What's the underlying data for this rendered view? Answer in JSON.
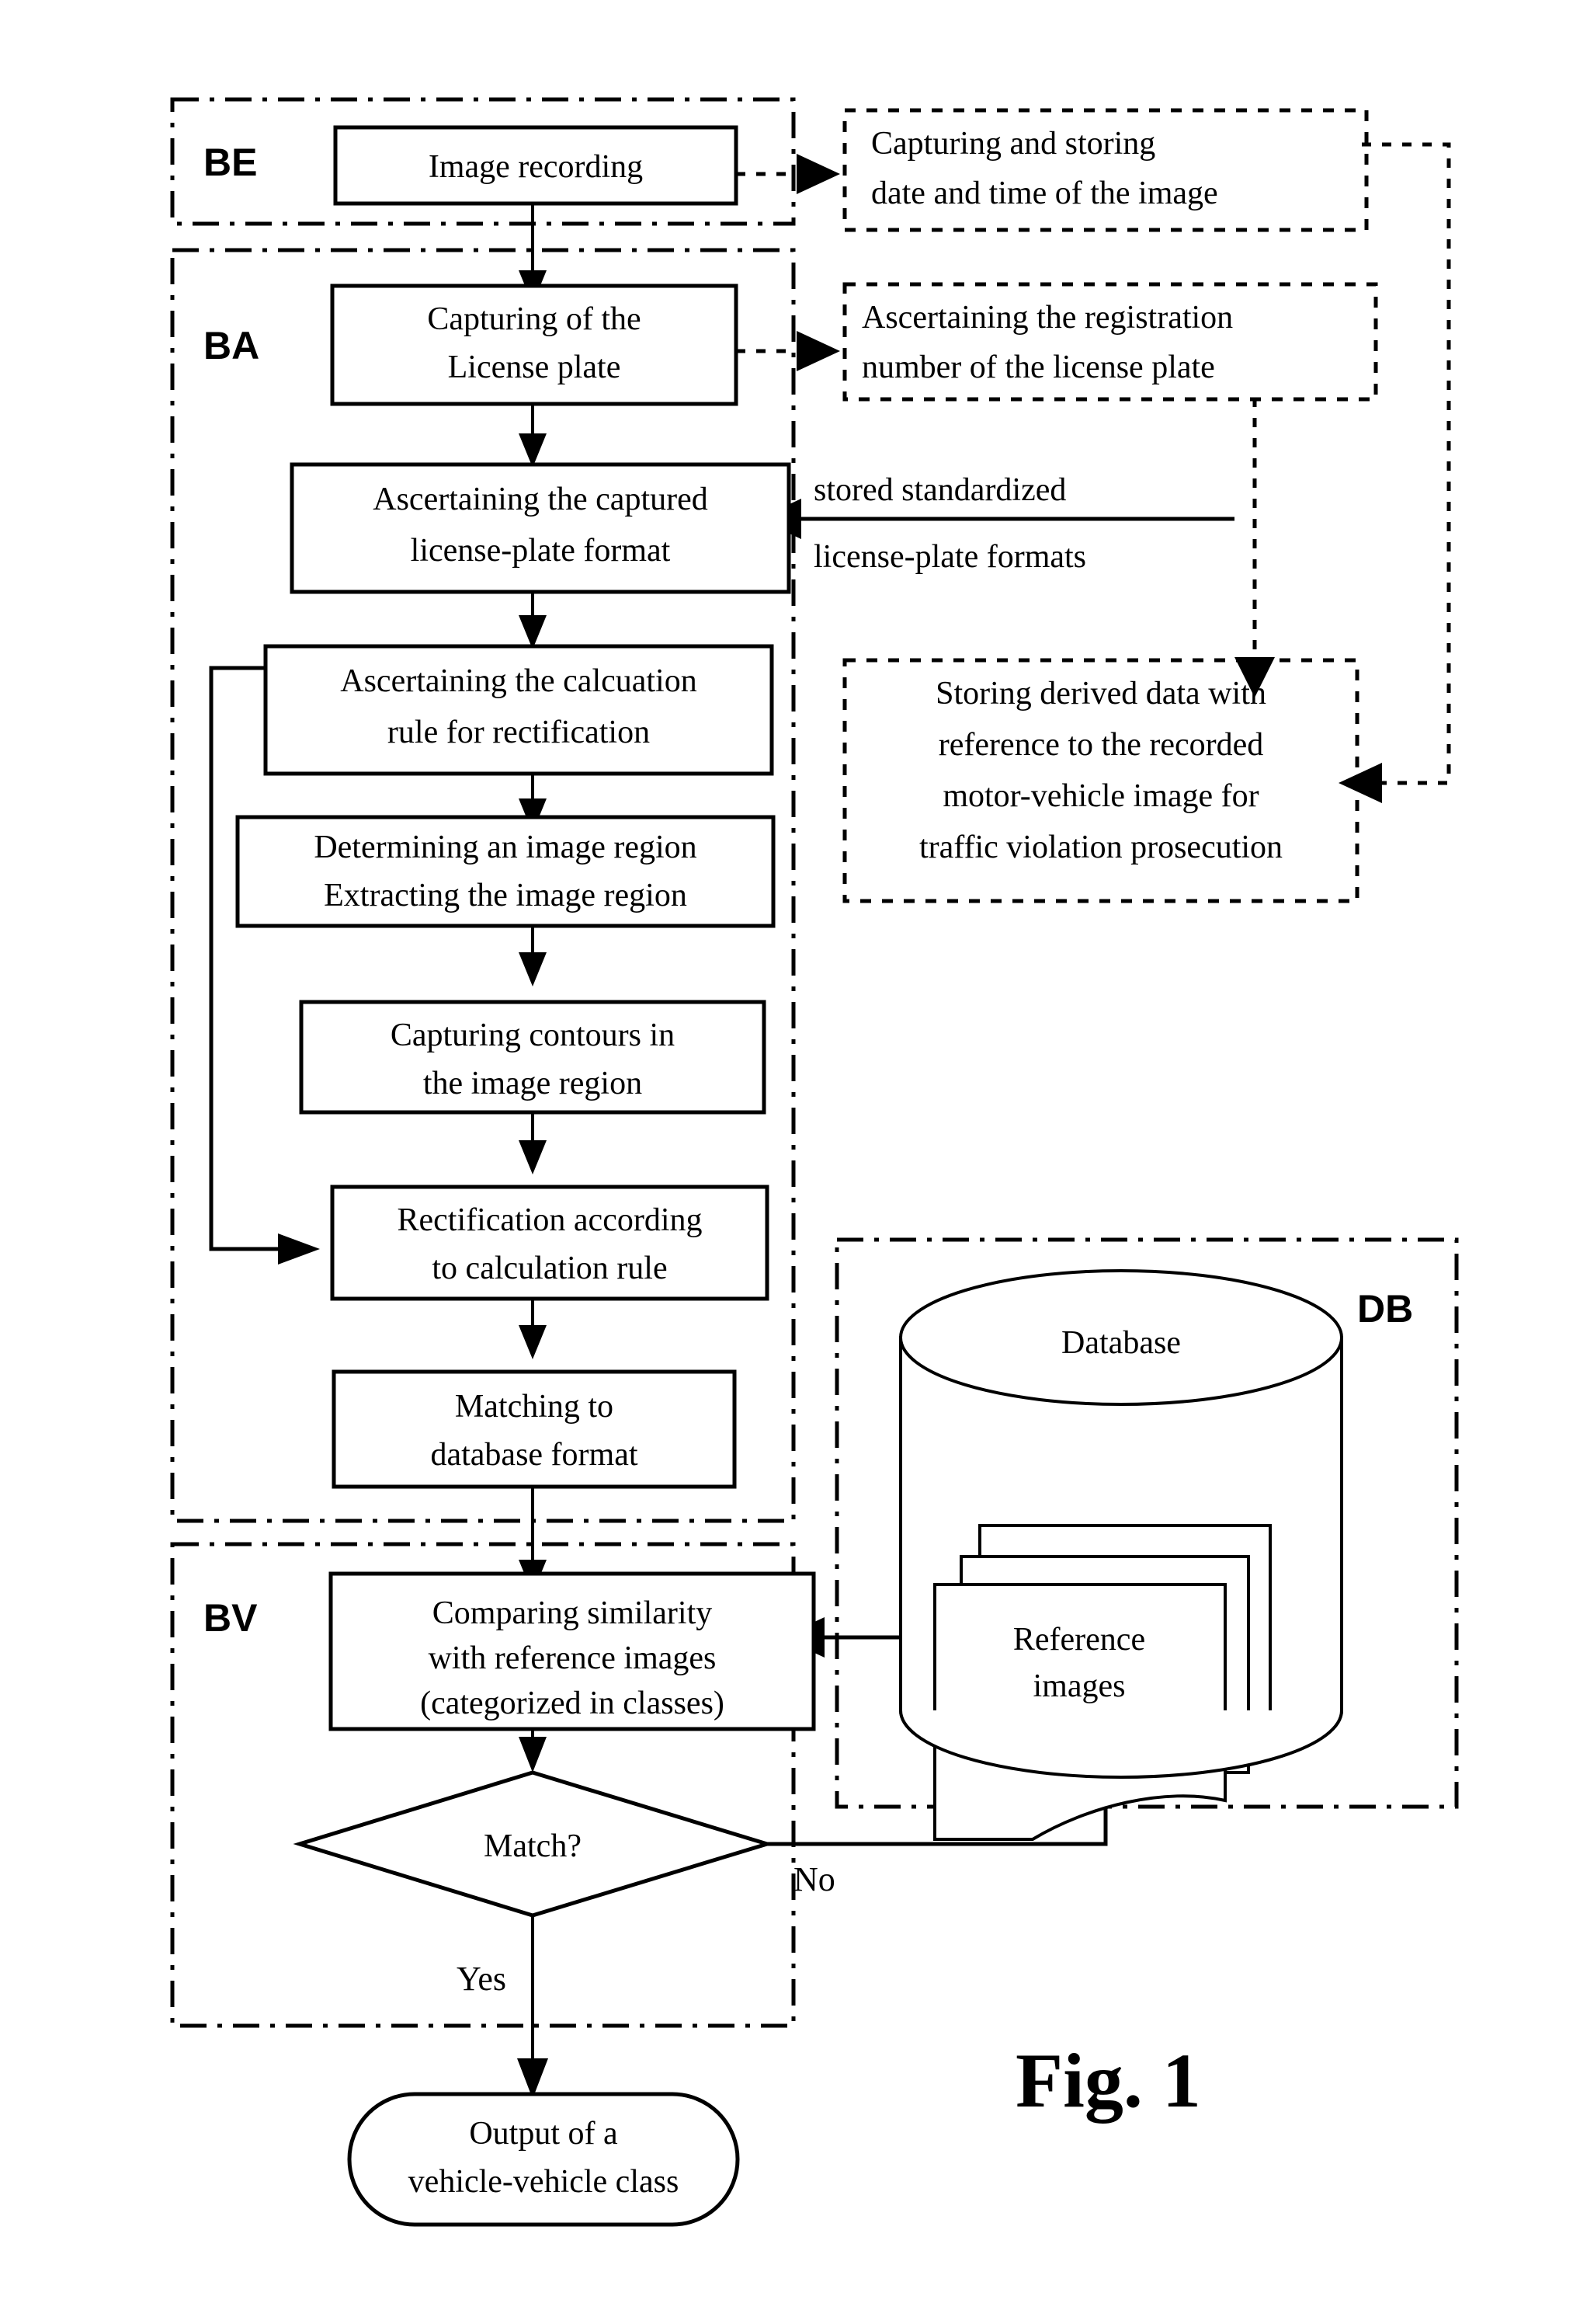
{
  "figure": {
    "caption": "Fig. 1",
    "group_labels": {
      "be": "BE",
      "ba": "BA",
      "bv": "BV",
      "db": "DB"
    }
  },
  "nodes": {
    "image_recording": {
      "line1": "Image recording"
    },
    "capturing_storing_datetime": {
      "line1": "Capturing and storing",
      "line2": "date and time of the image"
    },
    "capturing_license_plate": {
      "line1": "Capturing of the",
      "line2": "License plate"
    },
    "ascertaining_registration_number": {
      "line1": "Ascertaining the registration",
      "line2": "number of the license plate"
    },
    "ascertaining_captured_format": {
      "line1": "Ascertaining the captured",
      "line2": "license-plate format"
    },
    "stored_standardized_formats": {
      "line1": "stored standardized",
      "line2": "license-plate formats"
    },
    "ascertaining_calculation_rule": {
      "line1": "Ascertaining the calcuation",
      "line2": "rule for rectification"
    },
    "storing_derived_data": {
      "line1": "Storing derived data with",
      "line2": "reference to the recorded",
      "line3": "motor-vehicle image for",
      "line4": "traffic violation prosecution"
    },
    "determining_extracting_region": {
      "line1": "Determining an image region",
      "line2": "Extracting the image region"
    },
    "capturing_contours": {
      "line1": "Capturing contours in",
      "line2": "the image region"
    },
    "rectification": {
      "line1": "Rectification according",
      "line2": "to calculation rule"
    },
    "matching_database_format": {
      "line1": "Matching to",
      "line2": "database format"
    },
    "database_cylinder": {
      "line1": "Database"
    },
    "reference_images_stack": {
      "line1": "Reference",
      "line2": "images"
    },
    "comparing_similarity": {
      "line1": "Comparing similarity",
      "line2": "with reference images",
      "line3": "(categorized in classes)"
    },
    "match_decision": {
      "line1": "Match?"
    },
    "output_vehicle_class": {
      "line1": "Output of a",
      "line2": "vehicle-vehicle class"
    }
  },
  "branches": {
    "yes": "Yes",
    "no": "No"
  },
  "colors": {
    "stroke": "#000000",
    "fill": "#ffffff",
    "background": "#ffffff"
  }
}
